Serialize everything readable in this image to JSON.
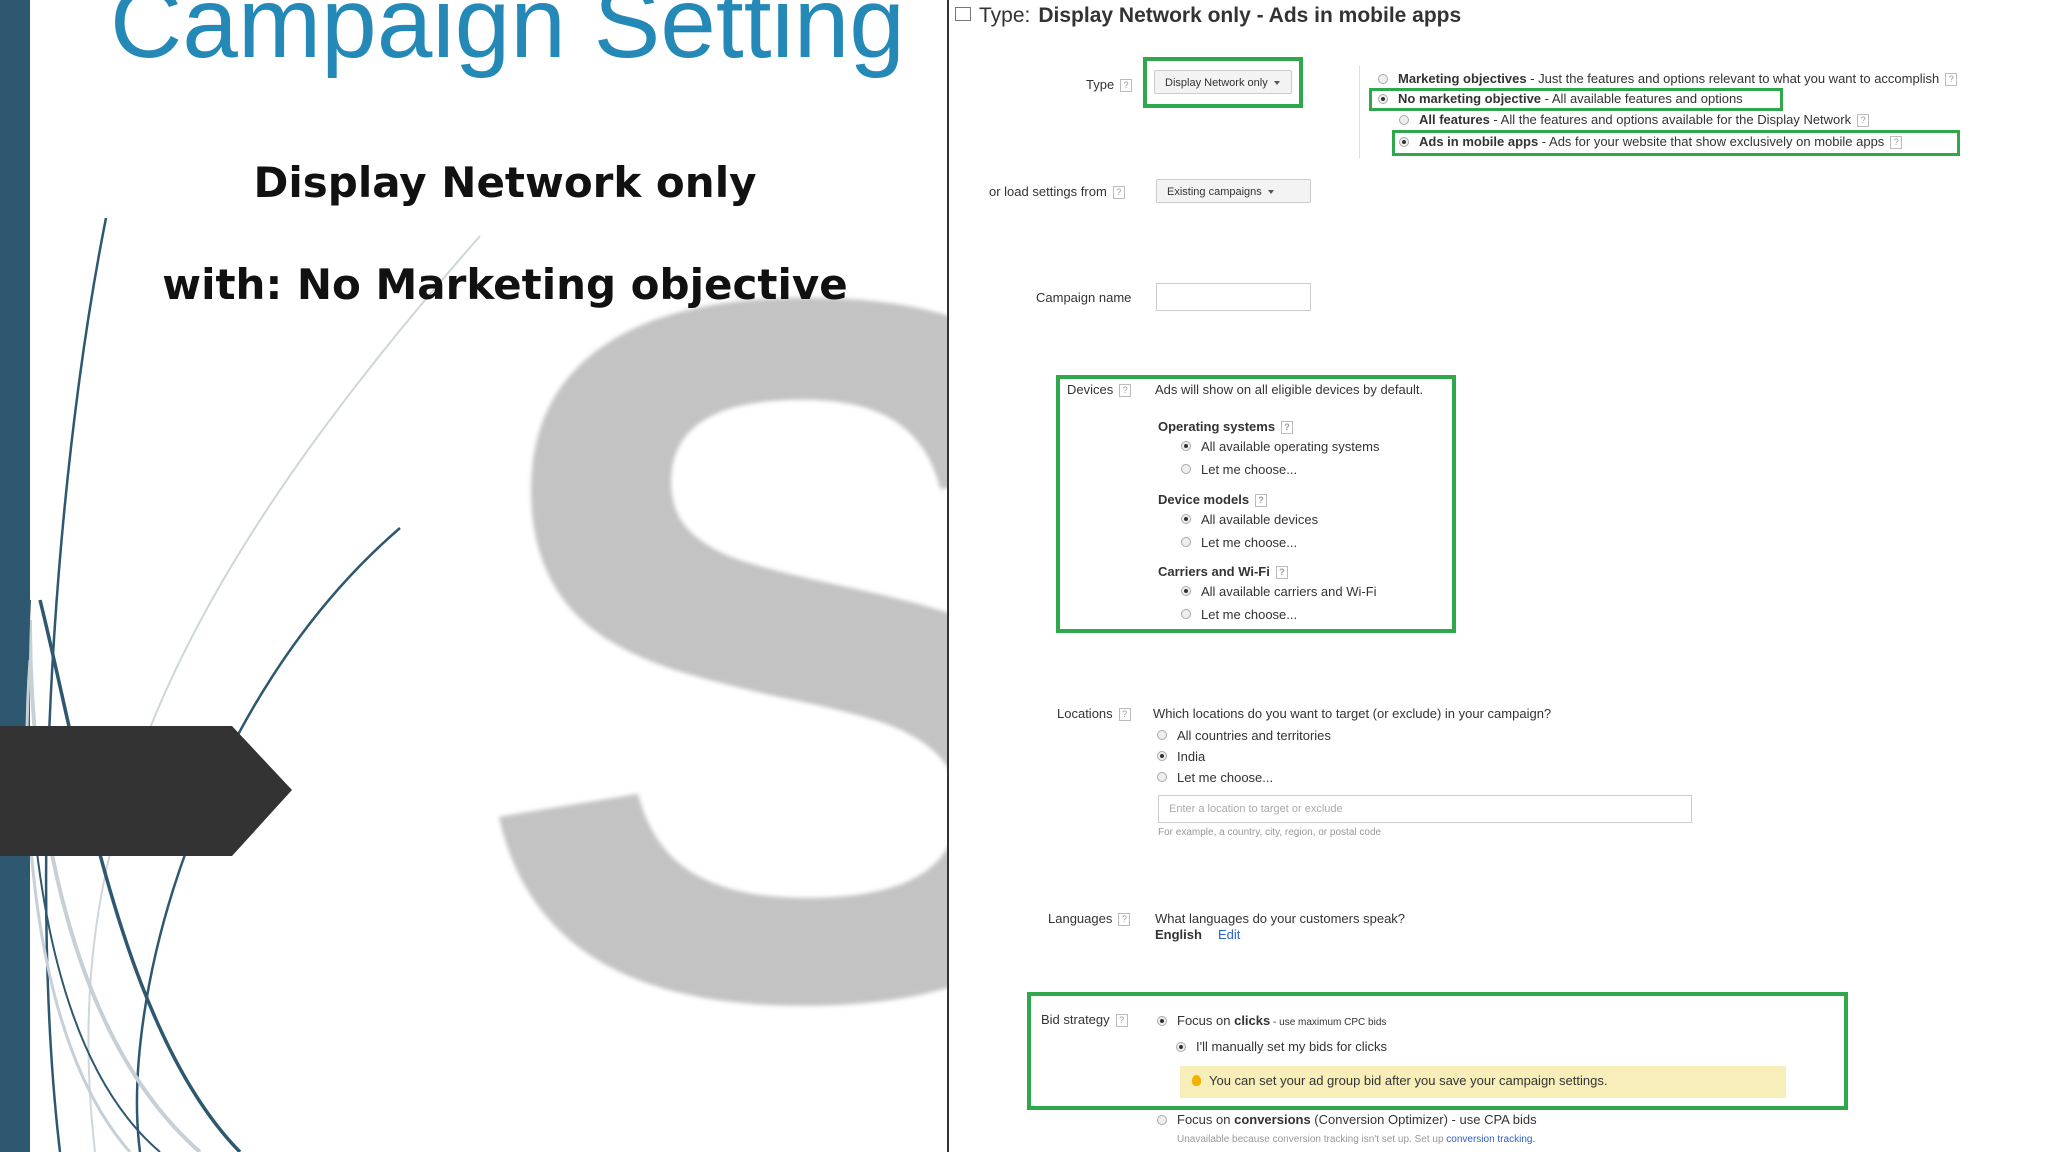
{
  "slide": {
    "title": "Campaign Setting",
    "subtitle_line1": "Display Network only",
    "subtitle_line2": "with: No Marketing objective",
    "watermark_letter": "S",
    "colors": {
      "title": "#2489b6",
      "bar": "#2e5870",
      "arrow": "#333333",
      "highlight": "#2ea84a"
    }
  },
  "screenshot": {
    "header_prefix": "Type:",
    "header_value": "Display Network only - Ads in mobile apps",
    "type": {
      "label": "Type",
      "dropdown": "Display Network only",
      "options": [
        {
          "name": "Marketing objectives",
          "desc": " - Just the features and options relevant to what you want to accomplish",
          "selected": false
        },
        {
          "name": "No marketing objective",
          "desc": " - All available features and options",
          "selected": true
        },
        {
          "name": "All features",
          "desc": " - All the features and options available for the Display Network",
          "selected": false
        },
        {
          "name": "Ads in mobile apps",
          "desc": " - Ads for your website that show exclusively on mobile apps",
          "selected": true
        }
      ]
    },
    "load_settings": {
      "label": "or load settings from",
      "dropdown": "Existing campaigns"
    },
    "campaign_name": {
      "label": "Campaign name",
      "value": ""
    },
    "devices": {
      "label": "Devices",
      "desc": "Ads will show on all eligible devices by default.",
      "os_title": "Operating systems",
      "os_all": "All available operating systems",
      "os_choose": "Let me choose...",
      "models_title": "Device models",
      "models_all": "All available devices",
      "models_choose": "Let me choose...",
      "carriers_title": "Carriers and Wi-Fi",
      "carriers_all": "All available carriers and Wi-Fi",
      "carriers_choose": "Let me choose..."
    },
    "locations": {
      "label": "Locations",
      "question": "Which locations do you want to target (or exclude) in your campaign?",
      "opt_all": "All countries and territories",
      "opt_india": "India",
      "opt_choose": "Let me choose...",
      "input_placeholder": "Enter a location to target or exclude",
      "hint": "For example, a country, city, region, or postal code"
    },
    "languages": {
      "label": "Languages",
      "question": "What languages do your customers speak?",
      "value": "English",
      "edit": "Edit"
    },
    "bid_strategy": {
      "label": "Bid strategy",
      "clicks_prefix": "Focus on ",
      "clicks_bold": "clicks",
      "clicks_suffix": " - use maximum CPC bids",
      "manual": "I'll manually set my bids for clicks",
      "notice": "You can set your ad group bid after you save your campaign settings.",
      "conv_prefix": "Focus on ",
      "conv_bold": "conversions",
      "conv_suffix": " (Conversion Optimizer) - use CPA bids",
      "unavailable": "Unavailable because conversion tracking isn't set up. Set up ",
      "unavailable_link": "conversion tracking."
    }
  }
}
